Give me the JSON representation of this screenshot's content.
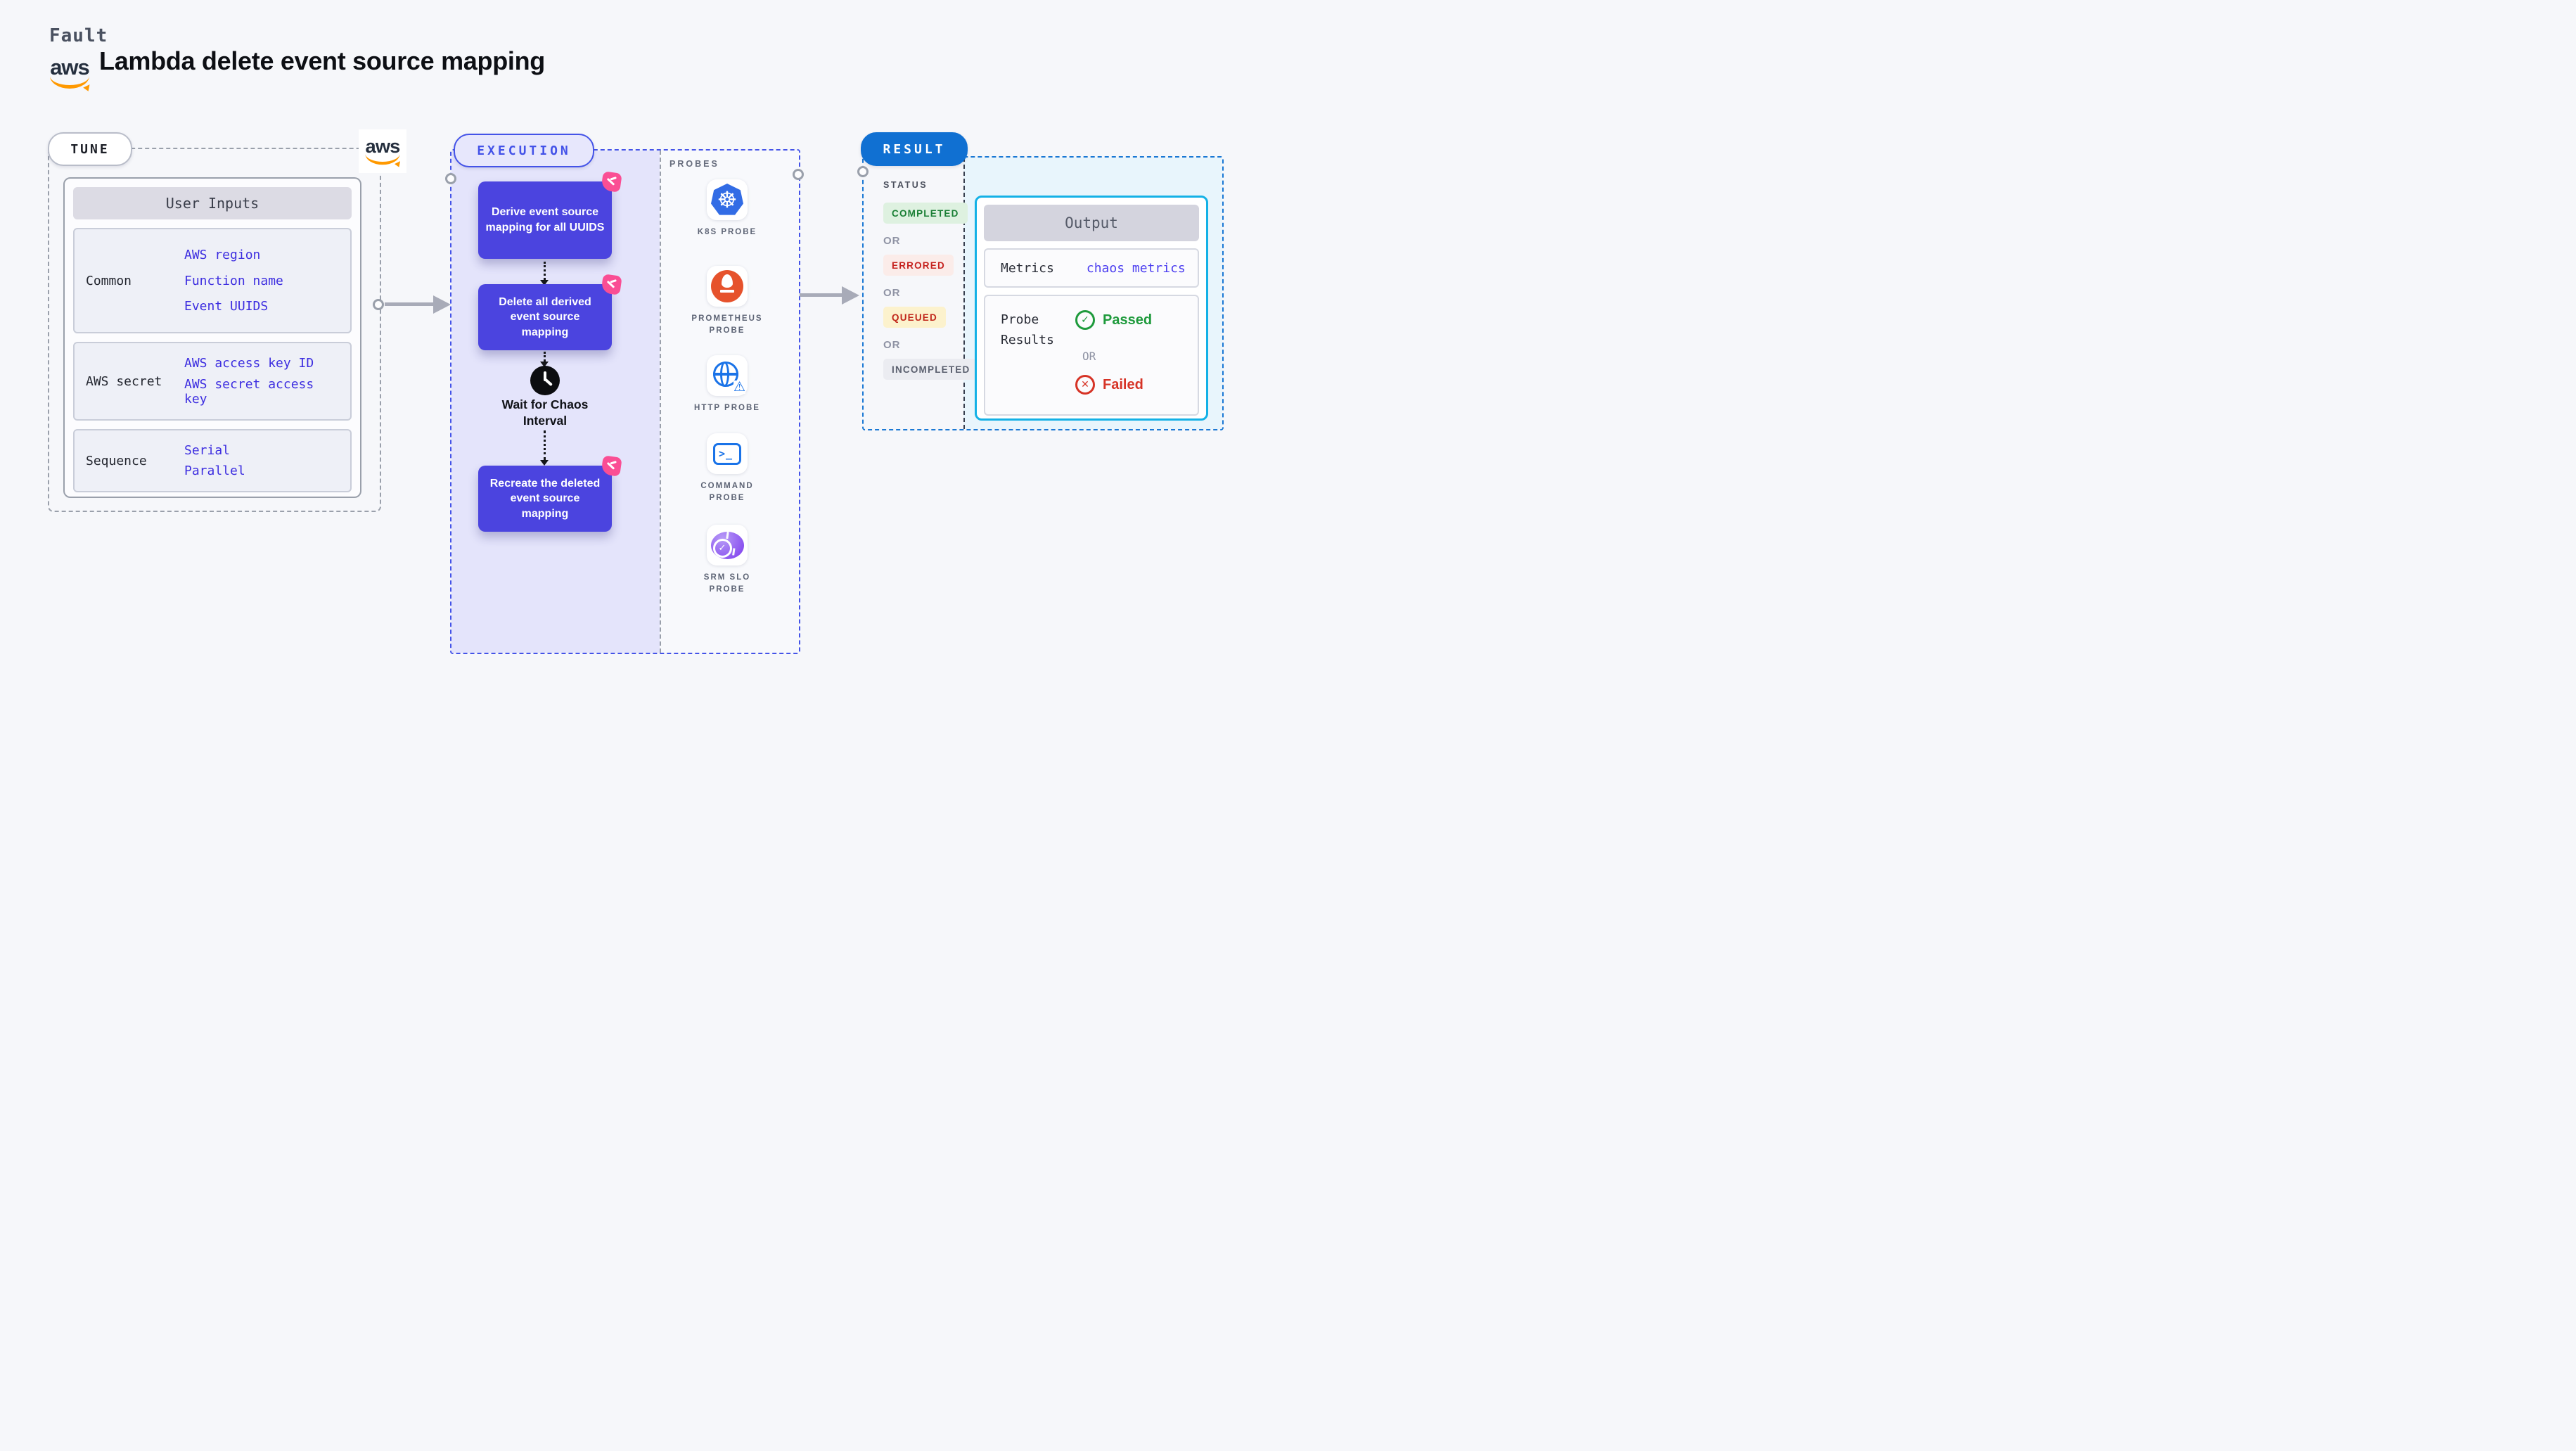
{
  "header": {
    "kicker": "Fault",
    "title": "Lambda delete event source mapping",
    "aws_logo_text": "aws"
  },
  "tune": {
    "badge": "TUNE",
    "card_title": "User Inputs",
    "rows": [
      {
        "label": "Common",
        "values": [
          "AWS region",
          "Function name",
          "Event UUIDS"
        ]
      },
      {
        "label": "AWS secret",
        "values": [
          "AWS access key ID",
          "AWS secret access\nkey"
        ]
      },
      {
        "label": "Sequence",
        "values": [
          "Serial",
          "Parallel"
        ]
      }
    ]
  },
  "execution": {
    "badge": "EXECUTION",
    "steps": [
      "Derive event source\nmapping for all UUIDS",
      "Delete all derived\nevent source\nmapping",
      "Wait for Chaos\nInterval",
      "Recreate the deleted\nevent source\nmapping"
    ],
    "probes": {
      "label": "PROBES",
      "items": [
        {
          "name": "k8s-probe",
          "label": "K8S PROBE"
        },
        {
          "name": "prometheus-probe",
          "label": "PROMETHEUS\nPROBE"
        },
        {
          "name": "http-probe",
          "label": "HTTP PROBE"
        },
        {
          "name": "command-probe",
          "label": "COMMAND\nPROBE"
        },
        {
          "name": "srm-slo-probe",
          "label": "SRM SLO\nPROBE"
        }
      ]
    }
  },
  "result": {
    "badge": "RESULT",
    "status_label": "STATUS",
    "or": "OR",
    "statuses": [
      {
        "label": "COMPLETED"
      },
      {
        "label": "ERRORED"
      },
      {
        "label": "QUEUED"
      },
      {
        "label": "INCOMPLETED"
      }
    ],
    "output": {
      "title": "Output",
      "metrics_label": "Metrics",
      "metrics_value": "chaos metrics",
      "probe_results_label": "Probe\nResults",
      "passed": "Passed",
      "or": "OR",
      "failed": "Failed"
    }
  },
  "colors": {
    "page_bg": "#f6f7fa",
    "flow_box": "#4b44df",
    "execution_border": "#4453e8",
    "lavender": "#e4e4fb",
    "result_blue": "#1070d2",
    "output_cyan": "#13b1e6",
    "flag_pink": "#fa4e94",
    "aws_orange": "#ff9900",
    "link_blue": "#3d2ee0",
    "passed_green": "#1e9a3c",
    "failed_red": "#d63326",
    "grey_dash": "#9aa0ab"
  }
}
